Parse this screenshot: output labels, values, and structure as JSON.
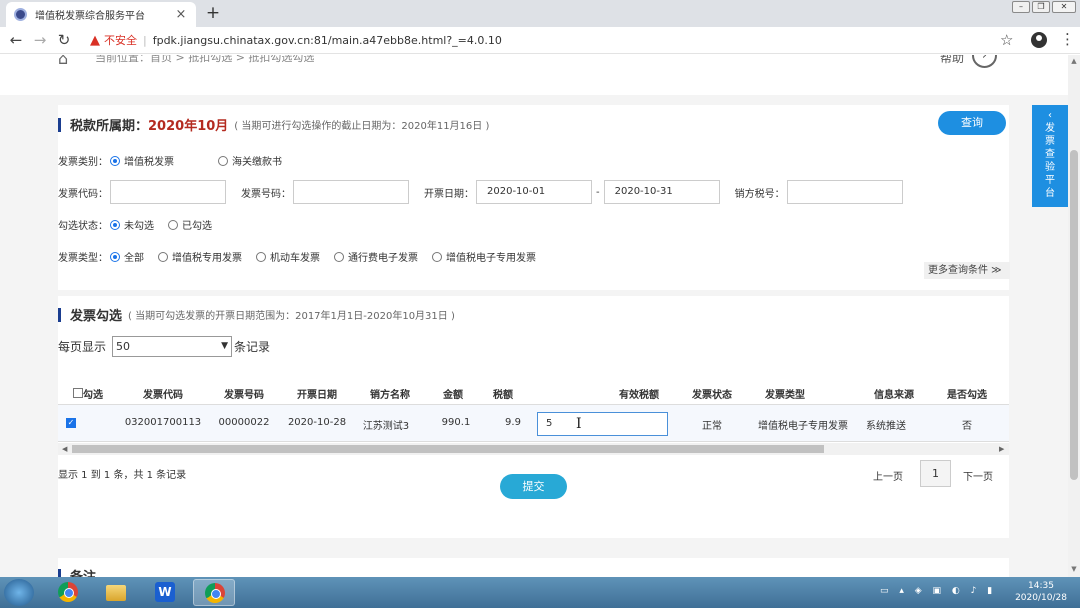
{
  "browser": {
    "tab_title": "增值税发票综合服务平台",
    "tab_close": "×",
    "new_tab": "+",
    "insecure_label": "不安全",
    "url": "fpdk.jiangsu.chinatax.gov.cn:81/main.a47ebb8e.html?_=4.0.10"
  },
  "page": {
    "breadcrumb": "当前位置：首页 > 抵扣勾选 > 抵扣勾选勾选",
    "help_label": "帮助",
    "side_tab": "发票查验平台",
    "query_section": {
      "title": "税款所属期：",
      "period": "2020年10月",
      "note": "( 当期可进行勾选操作的截止日期为：2020年11月16日 )",
      "query_button": "查询",
      "invoice_category_label": "发票类别：",
      "invoice_category_options": [
        "增值税发票",
        "海关缴款书"
      ],
      "invoice_code_label": "发票代码：",
      "invoice_code_value": "",
      "invoice_no_label": "发票号码：",
      "invoice_no_value": "",
      "issue_date_label": "开票日期：",
      "date_from": "2020-10-01",
      "date_sep": "-",
      "date_to": "2020-10-31",
      "seller_tax_label": "销方税号：",
      "seller_tax_value": "",
      "check_status_label": "勾选状态：",
      "check_status_options": [
        "未勾选",
        "已勾选"
      ],
      "invoice_type_label": "发票类型：",
      "invoice_type_options": [
        "全部",
        "增值税专用发票",
        "机动车发票",
        "通行费电子发票",
        "增值税电子专用发票"
      ],
      "more_conditions": "更多查询条件 ≫"
    },
    "select_section": {
      "title": "发票勾选",
      "note": "( 当期可勾选发票的开票日期范围为：2017年1月1日-2020年10月31日 )",
      "per_page_label": "每页显示",
      "per_page_value": "50",
      "per_page_suffix": "条记录",
      "columns": [
        "勾选",
        "发票代码",
        "发票号码",
        "开票日期",
        "销方名称",
        "金额",
        "税额",
        "有效税额",
        "发票状态",
        "发票类型",
        "信息来源",
        "是否勾选"
      ],
      "rows": [
        {
          "invoice_code": "032001700113",
          "invoice_no": "00000022",
          "issue_date": "2020-10-28",
          "seller_name": "江苏测试3",
          "amount": "990.1",
          "tax": "9.9",
          "valid_tax": "5",
          "status": "正常",
          "type": "增值税电子专用发票",
          "source": "系统推送",
          "checked": "否"
        }
      ],
      "summary": "显示 1 到 1 条，共 1 条记录",
      "prev": "上一页",
      "page": "1",
      "next": "下一页",
      "submit_button": "提交"
    },
    "remarks_title": "备注"
  },
  "taskbar": {
    "time": "14:35",
    "date": "2020/10/28",
    "wps_label": "W"
  }
}
